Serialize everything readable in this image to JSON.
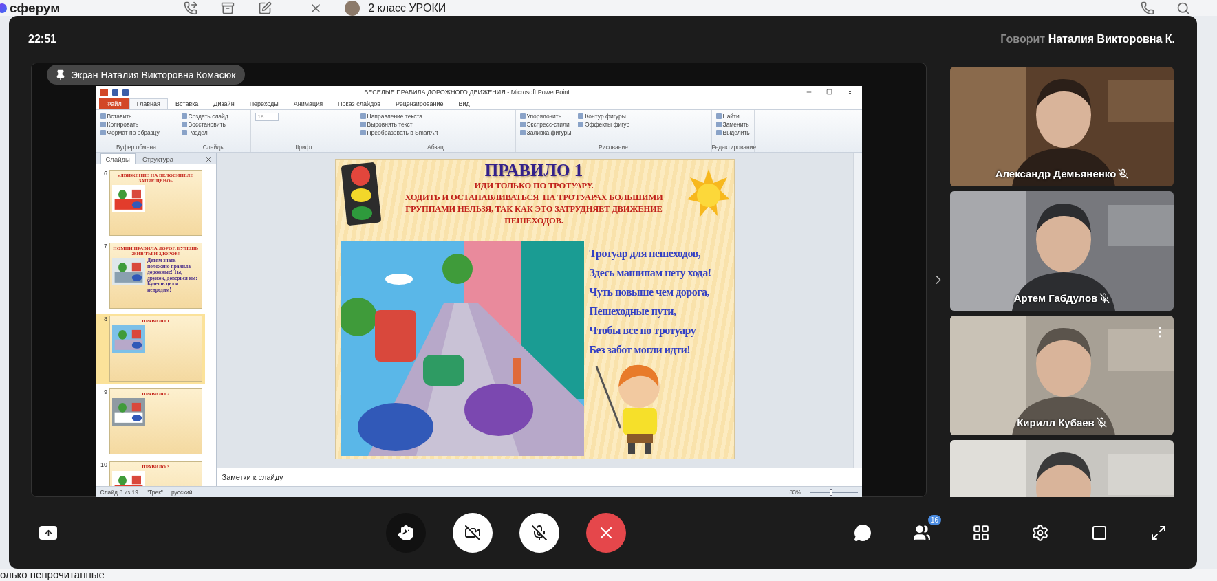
{
  "background_app": {
    "logo": "сферум",
    "chat_title": "2 класс УРОКИ",
    "filter_label": "олько непрочитанные"
  },
  "call": {
    "time": "22:51",
    "speaker_prefix": "Говорит",
    "speaker_name": "Наталия Викторовна К.",
    "screen_badge": "Экран Наталия Викторовна Комасюк"
  },
  "powerpoint": {
    "title": "ВЕСЕЛЫЕ ПРАВИЛА ДОРОЖНОГО ДВИЖЕНИЯ  -  Microsoft PowerPoint",
    "tabs": [
      {
        "label": "Файл",
        "selected": false,
        "kind": "file"
      },
      {
        "label": "Главная",
        "selected": true,
        "kind": "tab"
      },
      {
        "label": "Вставка",
        "selected": false,
        "kind": "tab"
      },
      {
        "label": "Дизайн",
        "selected": false,
        "kind": "tab"
      },
      {
        "label": "Переходы",
        "selected": false,
        "kind": "tab"
      },
      {
        "label": "Анимация",
        "selected": false,
        "kind": "tab"
      },
      {
        "label": "Показ слайдов",
        "selected": false,
        "kind": "tab"
      },
      {
        "label": "Рецензирование",
        "selected": false,
        "kind": "tab"
      },
      {
        "label": "Вид",
        "selected": false,
        "kind": "tab"
      }
    ],
    "ribbon_groups": [
      {
        "label": "Буфер обмена",
        "items": [
          "Вставить",
          "Копировать",
          "Формат по образцу"
        ]
      },
      {
        "label": "Слайды",
        "items": [
          "Создать слайд",
          "Восстановить",
          "Раздел"
        ]
      },
      {
        "label": "Шрифт",
        "items": [
          "18"
        ]
      },
      {
        "label": "Абзац",
        "items": [
          "Направление текста",
          "Выровнять текст",
          "Преобразовать в SmartArt"
        ]
      },
      {
        "label": "Рисование",
        "items": [
          "Упорядочить",
          "Экспресс-стили",
          "Заливка фигуры",
          "Контур фигуры",
          "Эффекты фигур"
        ]
      },
      {
        "label": "Редактирование",
        "items": [
          "Найти",
          "Заменить",
          "Выделить"
        ]
      }
    ],
    "pane_tabs": [
      {
        "label": "Слайды",
        "selected": true
      },
      {
        "label": "Структура",
        "selected": false
      }
    ],
    "thumbnails": [
      {
        "number": "6",
        "selected": false,
        "title": "«ДВИЖЕНИЕ НА ВЕЛОСИПЕДЕ ЗАПРЕЩЕНО»"
      },
      {
        "number": "7",
        "selected": false,
        "title": "ПОМНИ ПРАВИЛА ДОРОГ, БУДЕШЬ ЖИВ ТЫ И ЗДОРОВ!",
        "body": "Детям знать положено правила дорожные! Ты, дружок, доверься им: Будешь цел и невредим!"
      },
      {
        "number": "8",
        "selected": true,
        "title": "ПРАВИЛО 1"
      },
      {
        "number": "9",
        "selected": false,
        "title": "ПРАВИЛО 2"
      },
      {
        "number": "10",
        "selected": false,
        "title": "ПРАВИЛО 3"
      }
    ],
    "slide": {
      "title": "ПРАВИЛО 1",
      "rule_lines": [
        "ИДИ ТОЛЬКО ПО ТРОТУАРУ.",
        "ХОДИТЬ И ОСТАНАВЛИВАТЬСЯ  НА ТРОТУАРАХ БОЛЬШИМИ",
        "ГРУППАМИ НЕЛЬЗЯ, ТАК КАК ЭТО ЗАТРУДНЯЕТ ДВИЖЕНИЕ",
        "ПЕШЕХОДОВ."
      ],
      "poem": [
        "Тротуар для пешеходов,",
        "Здесь машинам нету хода!",
        "Чуть повыше чем дорога,",
        "Пешеходные пути,",
        "Чтобы все по тротуару",
        "Без забот могли идти!"
      ]
    },
    "notes_placeholder": "Заметки к слайду",
    "status": {
      "slide": "Слайд 8 из 19",
      "theme": "\"Трек\"",
      "language": "русский",
      "zoom": "83%",
      "level": 0.45
    }
  },
  "participants": [
    {
      "name": "Александр Демьяненко",
      "muted": true,
      "menu_shown": false
    },
    {
      "name": "Артем Габдулов",
      "muted": true,
      "menu_shown": false
    },
    {
      "name": "Кирилл Кубаев",
      "muted": true,
      "menu_shown": true
    },
    {
      "kind": "picture"
    }
  ],
  "controls": {
    "hand_raised": false,
    "camera_on": false,
    "mic_on": false,
    "participants_badge": "16"
  }
}
